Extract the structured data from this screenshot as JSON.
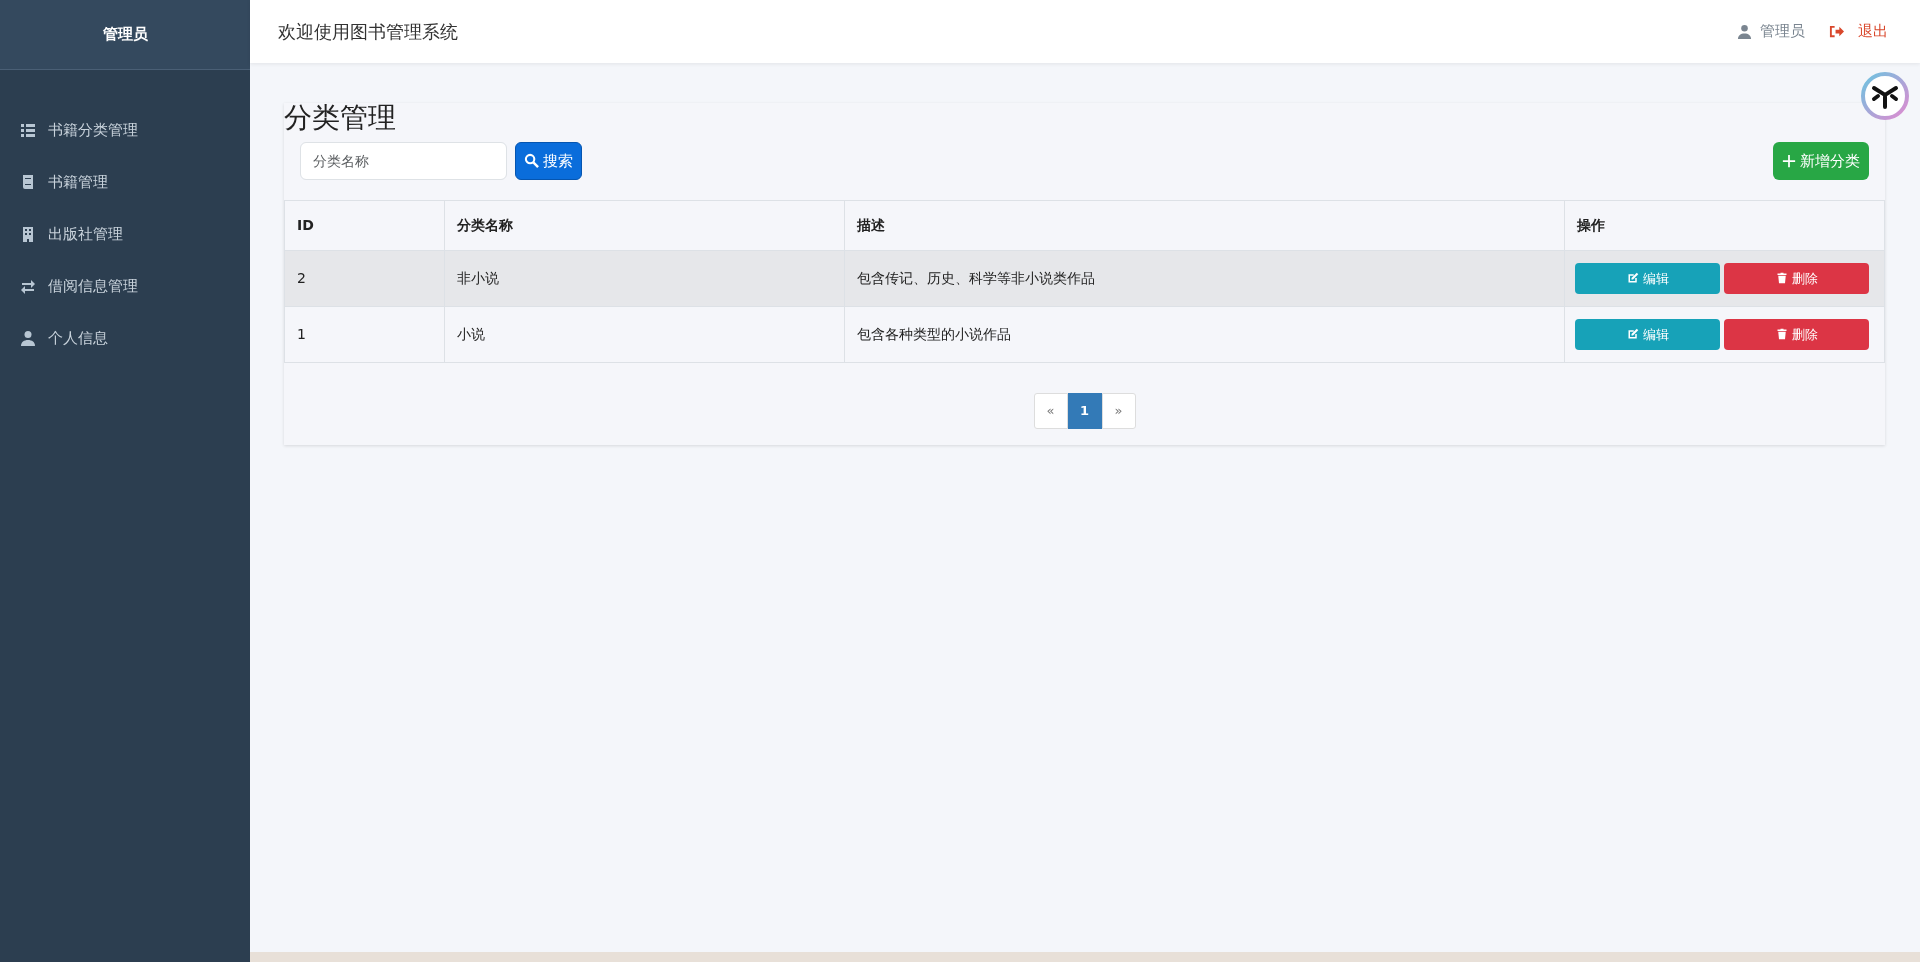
{
  "sidebar": {
    "title": "管理员",
    "items": [
      {
        "label": "书籍分类管理",
        "selected": false
      },
      {
        "label": "书籍管理",
        "selected": false
      },
      {
        "label": "出版社管理",
        "selected": false
      },
      {
        "label": "借阅信息管理",
        "selected": false
      },
      {
        "label": "个人信息",
        "selected": false
      }
    ]
  },
  "header": {
    "title": "欢迎使用图书管理系统",
    "user": "管理员",
    "logout": "退出"
  },
  "page": {
    "title": "分类管理",
    "search": {
      "placeholder": "分类名称",
      "button": "搜索"
    },
    "add_button": "新增分类"
  },
  "table": {
    "columns": [
      "ID",
      "分类名称",
      "描述",
      "操作"
    ],
    "rows": [
      {
        "cells": [
          "2",
          "非小说",
          "包含传记、历史、科学等非小说类作品"
        ],
        "highlighted": true,
        "actions": [
          "编辑",
          "删除"
        ]
      },
      {
        "cells": [
          "1",
          "小说",
          "包含各种类型的小说作品"
        ],
        "highlighted": false,
        "actions": [
          "编辑",
          "删除"
        ]
      }
    ]
  },
  "pagination": [
    {
      "label": "«",
      "selected": false
    },
    {
      "label": "1",
      "selected": true
    },
    {
      "label": "»",
      "selected": false
    }
  ]
}
